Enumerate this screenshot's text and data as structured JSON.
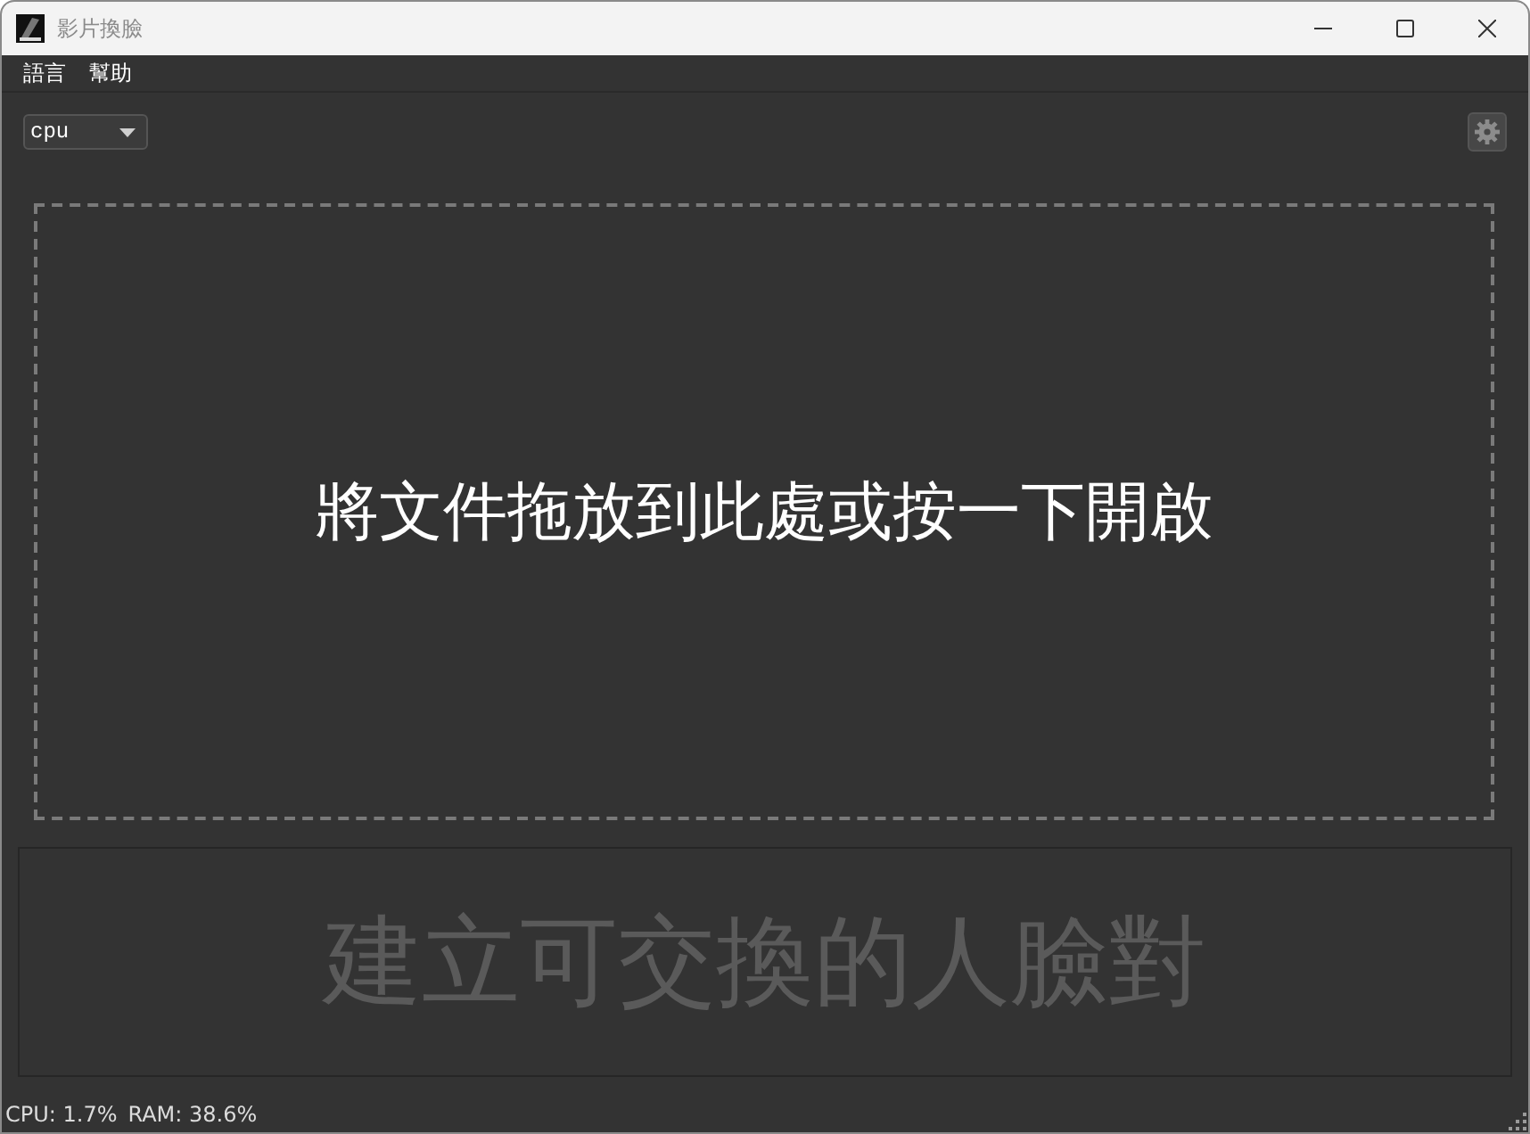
{
  "window": {
    "title": "影片換臉"
  },
  "menu": [
    {
      "label": "語言"
    },
    {
      "label": "幫助"
    }
  ],
  "device_select": {
    "value": "cpu"
  },
  "drop_zone": {
    "text": "將文件拖放到此處或按一下開啟"
  },
  "face_pairs_panel": {
    "text": "建立可交換的人臉對"
  },
  "status_bar": {
    "cpu": "CPU: 1.7%",
    "ram": "RAM: 38.6%"
  }
}
